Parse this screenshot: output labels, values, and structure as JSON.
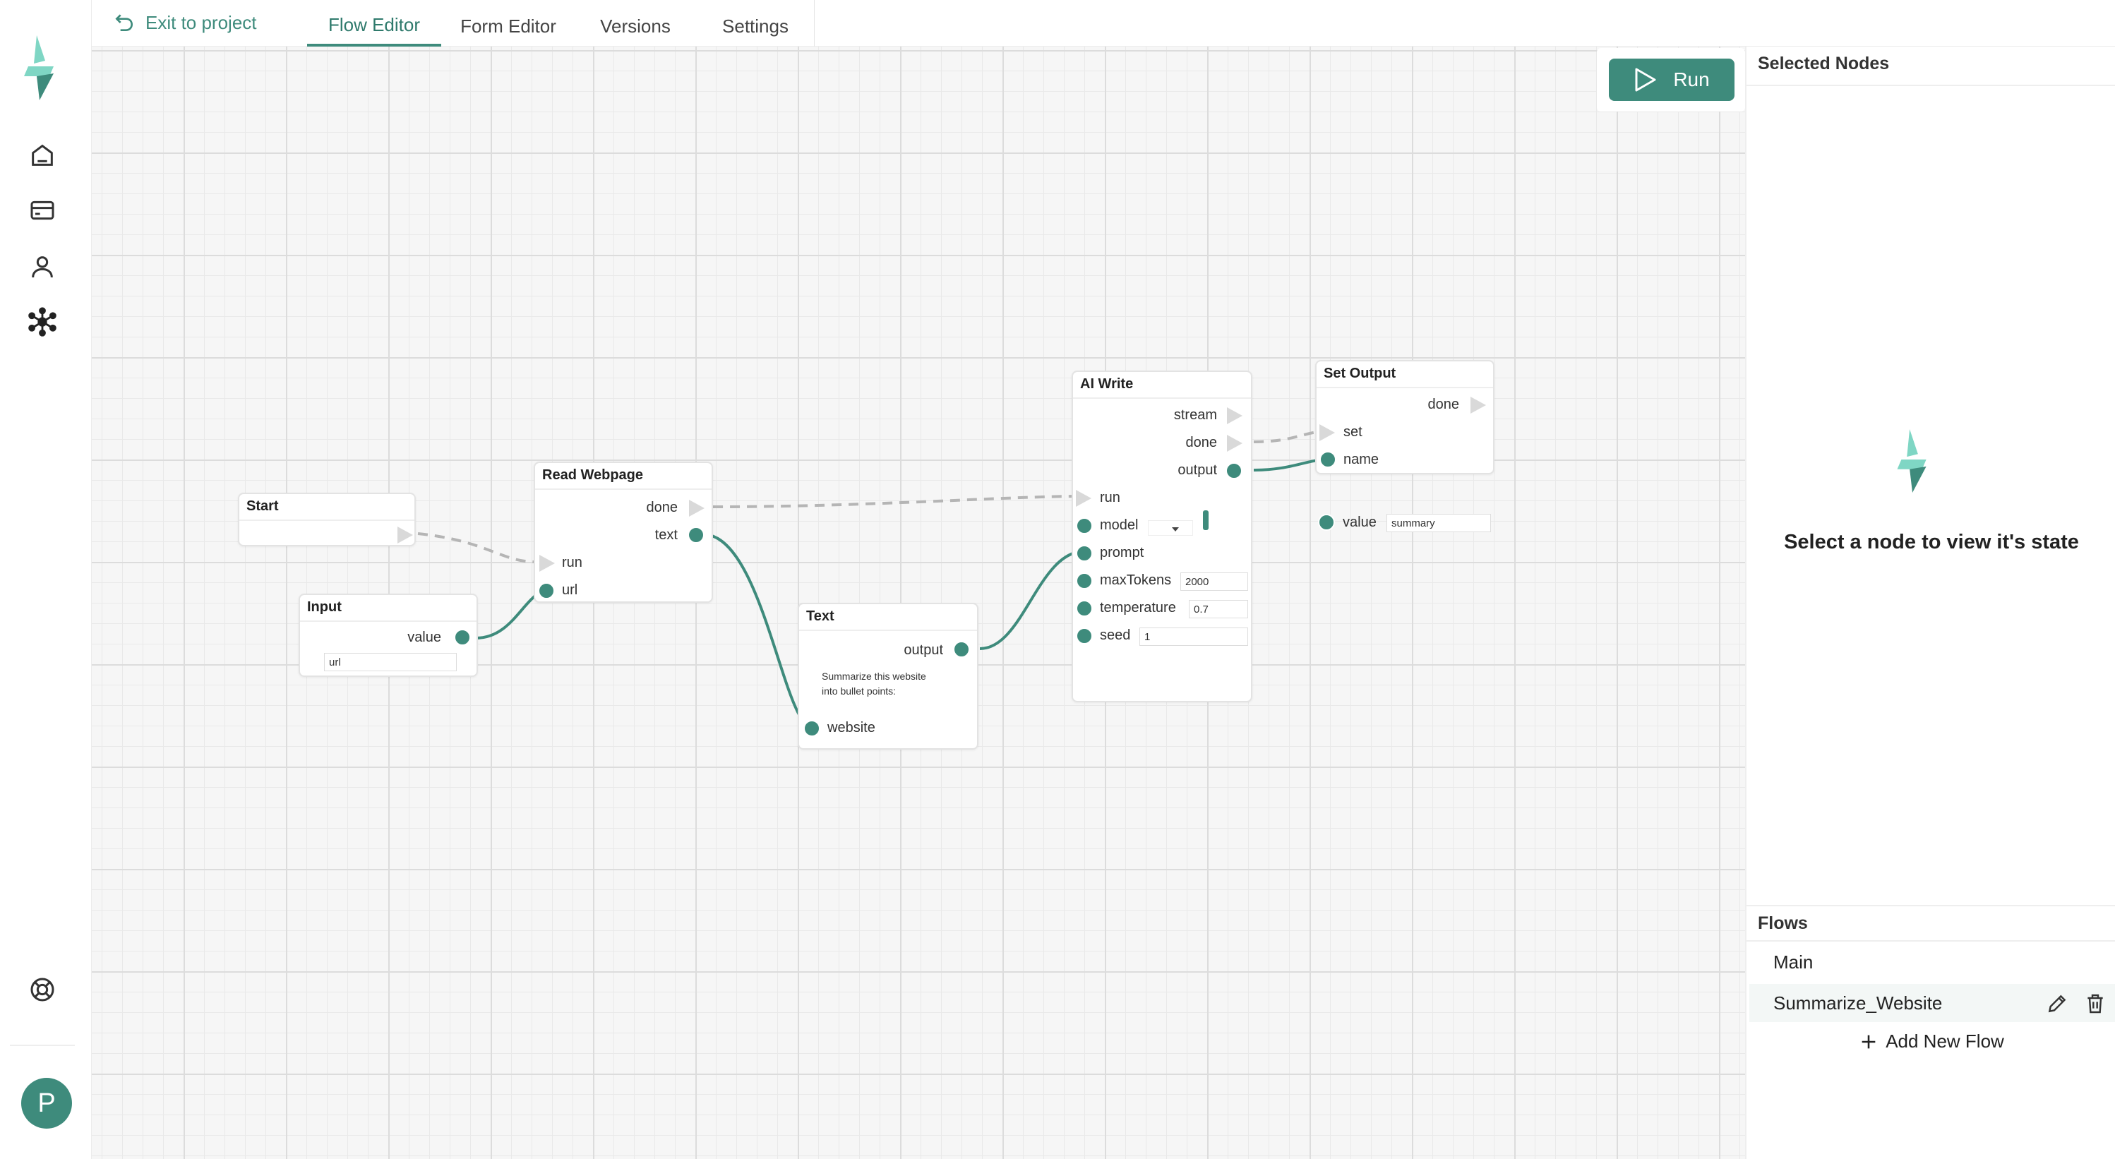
{
  "topbar": {
    "exit_label": "Exit to project",
    "tabs": [
      {
        "label": "Flow Editor",
        "active": true
      },
      {
        "label": "Form Editor",
        "active": false
      },
      {
        "label": "Versions",
        "active": false
      },
      {
        "label": "Settings",
        "active": false
      }
    ]
  },
  "sidebar": {
    "icons": [
      "home-icon",
      "card-icon",
      "user-icon",
      "network-icon",
      "help-icon"
    ],
    "avatar_initial": "P"
  },
  "toolbar": {
    "run_label": "Run"
  },
  "nodes": {
    "start": {
      "title": "Start"
    },
    "input": {
      "title": "Input",
      "value_label": "value",
      "input_value": "url"
    },
    "read_webpage": {
      "title": "Read Webpage",
      "done": "done",
      "text": "text",
      "run": "run",
      "url": "url"
    },
    "text": {
      "title": "Text",
      "output": "output",
      "content": "Summarize this website into bullet points:",
      "website": "website"
    },
    "ai_write": {
      "title": "AI Write",
      "stream": "stream",
      "done": "done",
      "output": "output",
      "run": "run",
      "model": "model",
      "prompt": "prompt",
      "maxTokens": "maxTokens",
      "maxTokens_value": "2000",
      "temperature": "temperature",
      "temperature_value": "0.7",
      "seed": "seed",
      "seed_value": "1"
    },
    "set_output": {
      "title": "Set Output",
      "done": "done",
      "set": "set",
      "name": "name",
      "value": "value",
      "value_input": "summary"
    }
  },
  "right_panel": {
    "selected_title": "Selected Nodes",
    "empty_message": "Select a node to view it's state",
    "flows_title": "Flows",
    "flows": [
      "Main",
      "Summarize_Website"
    ],
    "add_flow_label": "Add New Flow"
  },
  "colors": {
    "accent": "#3e8b7c",
    "canvas": "#f6f6f6",
    "grid": "#dcdcdc",
    "wire": "#3e8b7c",
    "exec_wire": "#b5b5b5"
  }
}
